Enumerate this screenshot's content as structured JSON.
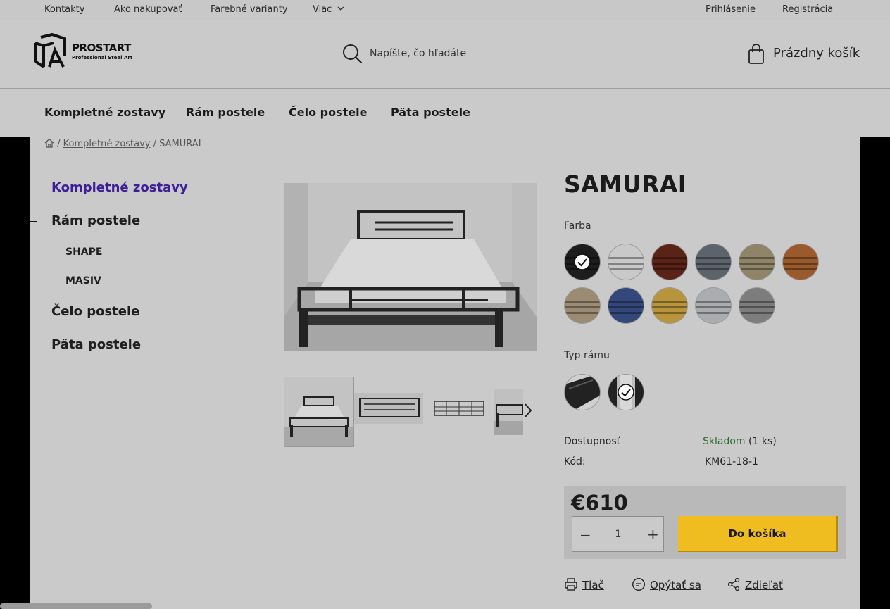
{
  "topbar": {
    "links": [
      "Kontakty",
      "Ako nakupovať",
      "Farebné varianty",
      "Viac"
    ],
    "login": "Prihlásenie",
    "register": "Registrácia"
  },
  "header": {
    "logo_name": "PROSTART",
    "logo_sub": "Professional Steel Art",
    "search_placeholder": "Napíšte, čo hľadáte",
    "cart_label": "Prázdny košík"
  },
  "catnav": [
    "Kompletné zostavy",
    "Rám postele",
    "Čelo postele",
    "Päta postele"
  ],
  "breadcrumb": {
    "separator": "/",
    "category": "Kompletné zostavy",
    "current": "SAMURAI"
  },
  "sidebar": {
    "items": [
      {
        "label": "Kompletné zostavy",
        "level": 1,
        "active": true
      },
      {
        "label": "Rám postele",
        "level": 1,
        "active": false
      },
      {
        "label": "SHAPE",
        "level": 2,
        "active": false
      },
      {
        "label": "MASIV",
        "level": 2,
        "active": false
      },
      {
        "label": "Čelo postele",
        "level": 1,
        "active": false
      },
      {
        "label": "Päta postele",
        "level": 1,
        "active": false
      }
    ]
  },
  "product": {
    "title": "SAMURAI",
    "color_label": "Farba",
    "frame_label": "Typ rámu",
    "colors": [
      {
        "hex": "#1d1d1d",
        "selected": true
      },
      {
        "hex": "#c9c9c9",
        "selected": false
      },
      {
        "hex": "#5a2318",
        "selected": false
      },
      {
        "hex": "#5c636b",
        "selected": false
      },
      {
        "hex": "#8f8468",
        "selected": false
      },
      {
        "hex": "#9a5a2c",
        "selected": false
      },
      {
        "hex": "#9a8b72",
        "selected": false
      },
      {
        "hex": "#34477a",
        "selected": false
      },
      {
        "hex": "#b8953d",
        "selected": false
      },
      {
        "hex": "#a9adb0",
        "selected": false
      },
      {
        "hex": "#7d7d7d",
        "selected": false
      }
    ],
    "frame_types": [
      {
        "name": "profile-angle",
        "selected": false
      },
      {
        "name": "profile-round",
        "selected": true
      }
    ],
    "availability_label": "Dostupnosť",
    "availability_value": "Skladom",
    "availability_qty": "(1 ks)",
    "code_label": "Kód:",
    "code_value": "KM61-18-1",
    "price": "€610",
    "quantity": "1",
    "add_to_cart": "Do košíka"
  },
  "actions": {
    "print": "Tlač",
    "ask": "Opýtať sa",
    "share": "Zdieľať"
  },
  "colors": {
    "accent_purple": "#3c1f96",
    "button_yellow": "#f0bd21",
    "stock_green": "#2d6b2d"
  }
}
